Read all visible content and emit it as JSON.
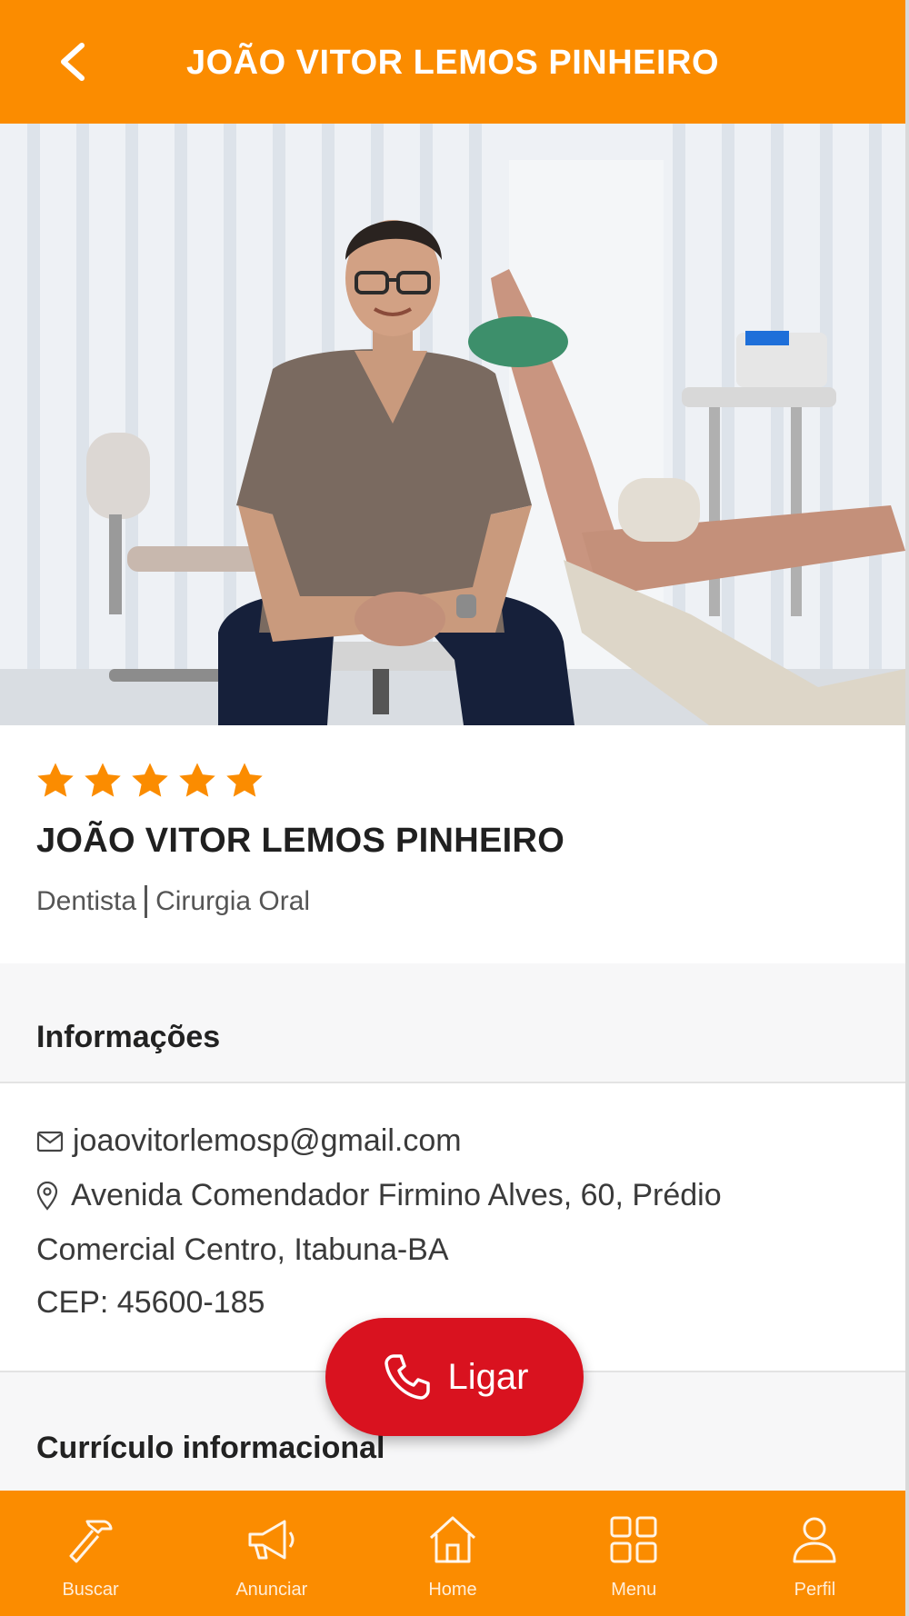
{
  "header": {
    "title": "JOÃO VITOR LEMOS PINHEIRO"
  },
  "profile": {
    "rating": 5,
    "rating_max": 5,
    "name": "JOÃO VITOR LEMOS PINHEIRO",
    "role": "Dentista",
    "specialty": "Cirurgia Oral"
  },
  "info": {
    "heading": "Informações",
    "email": "joaovitorlemosp@gmail.com",
    "address_line1": "Avenida Comendador Firmino Alves, 60, Prédio",
    "address_line2": "Comercial Centro, Itabuna-BA",
    "cep": "CEP: 45600-185"
  },
  "curriculum": {
    "heading": "Currículo informacional"
  },
  "call_button": {
    "label": "Ligar"
  },
  "bottom_nav": {
    "items": [
      {
        "label": "Buscar",
        "icon": "hammer-icon"
      },
      {
        "label": "Anunciar",
        "icon": "megaphone-icon"
      },
      {
        "label": "Home",
        "icon": "home-icon"
      },
      {
        "label": "Menu",
        "icon": "grid-icon"
      },
      {
        "label": "Perfil",
        "icon": "user-icon"
      }
    ]
  },
  "colors": {
    "accent": "#fb8c00",
    "call": "#d9121f",
    "star": "#fb8c00"
  }
}
